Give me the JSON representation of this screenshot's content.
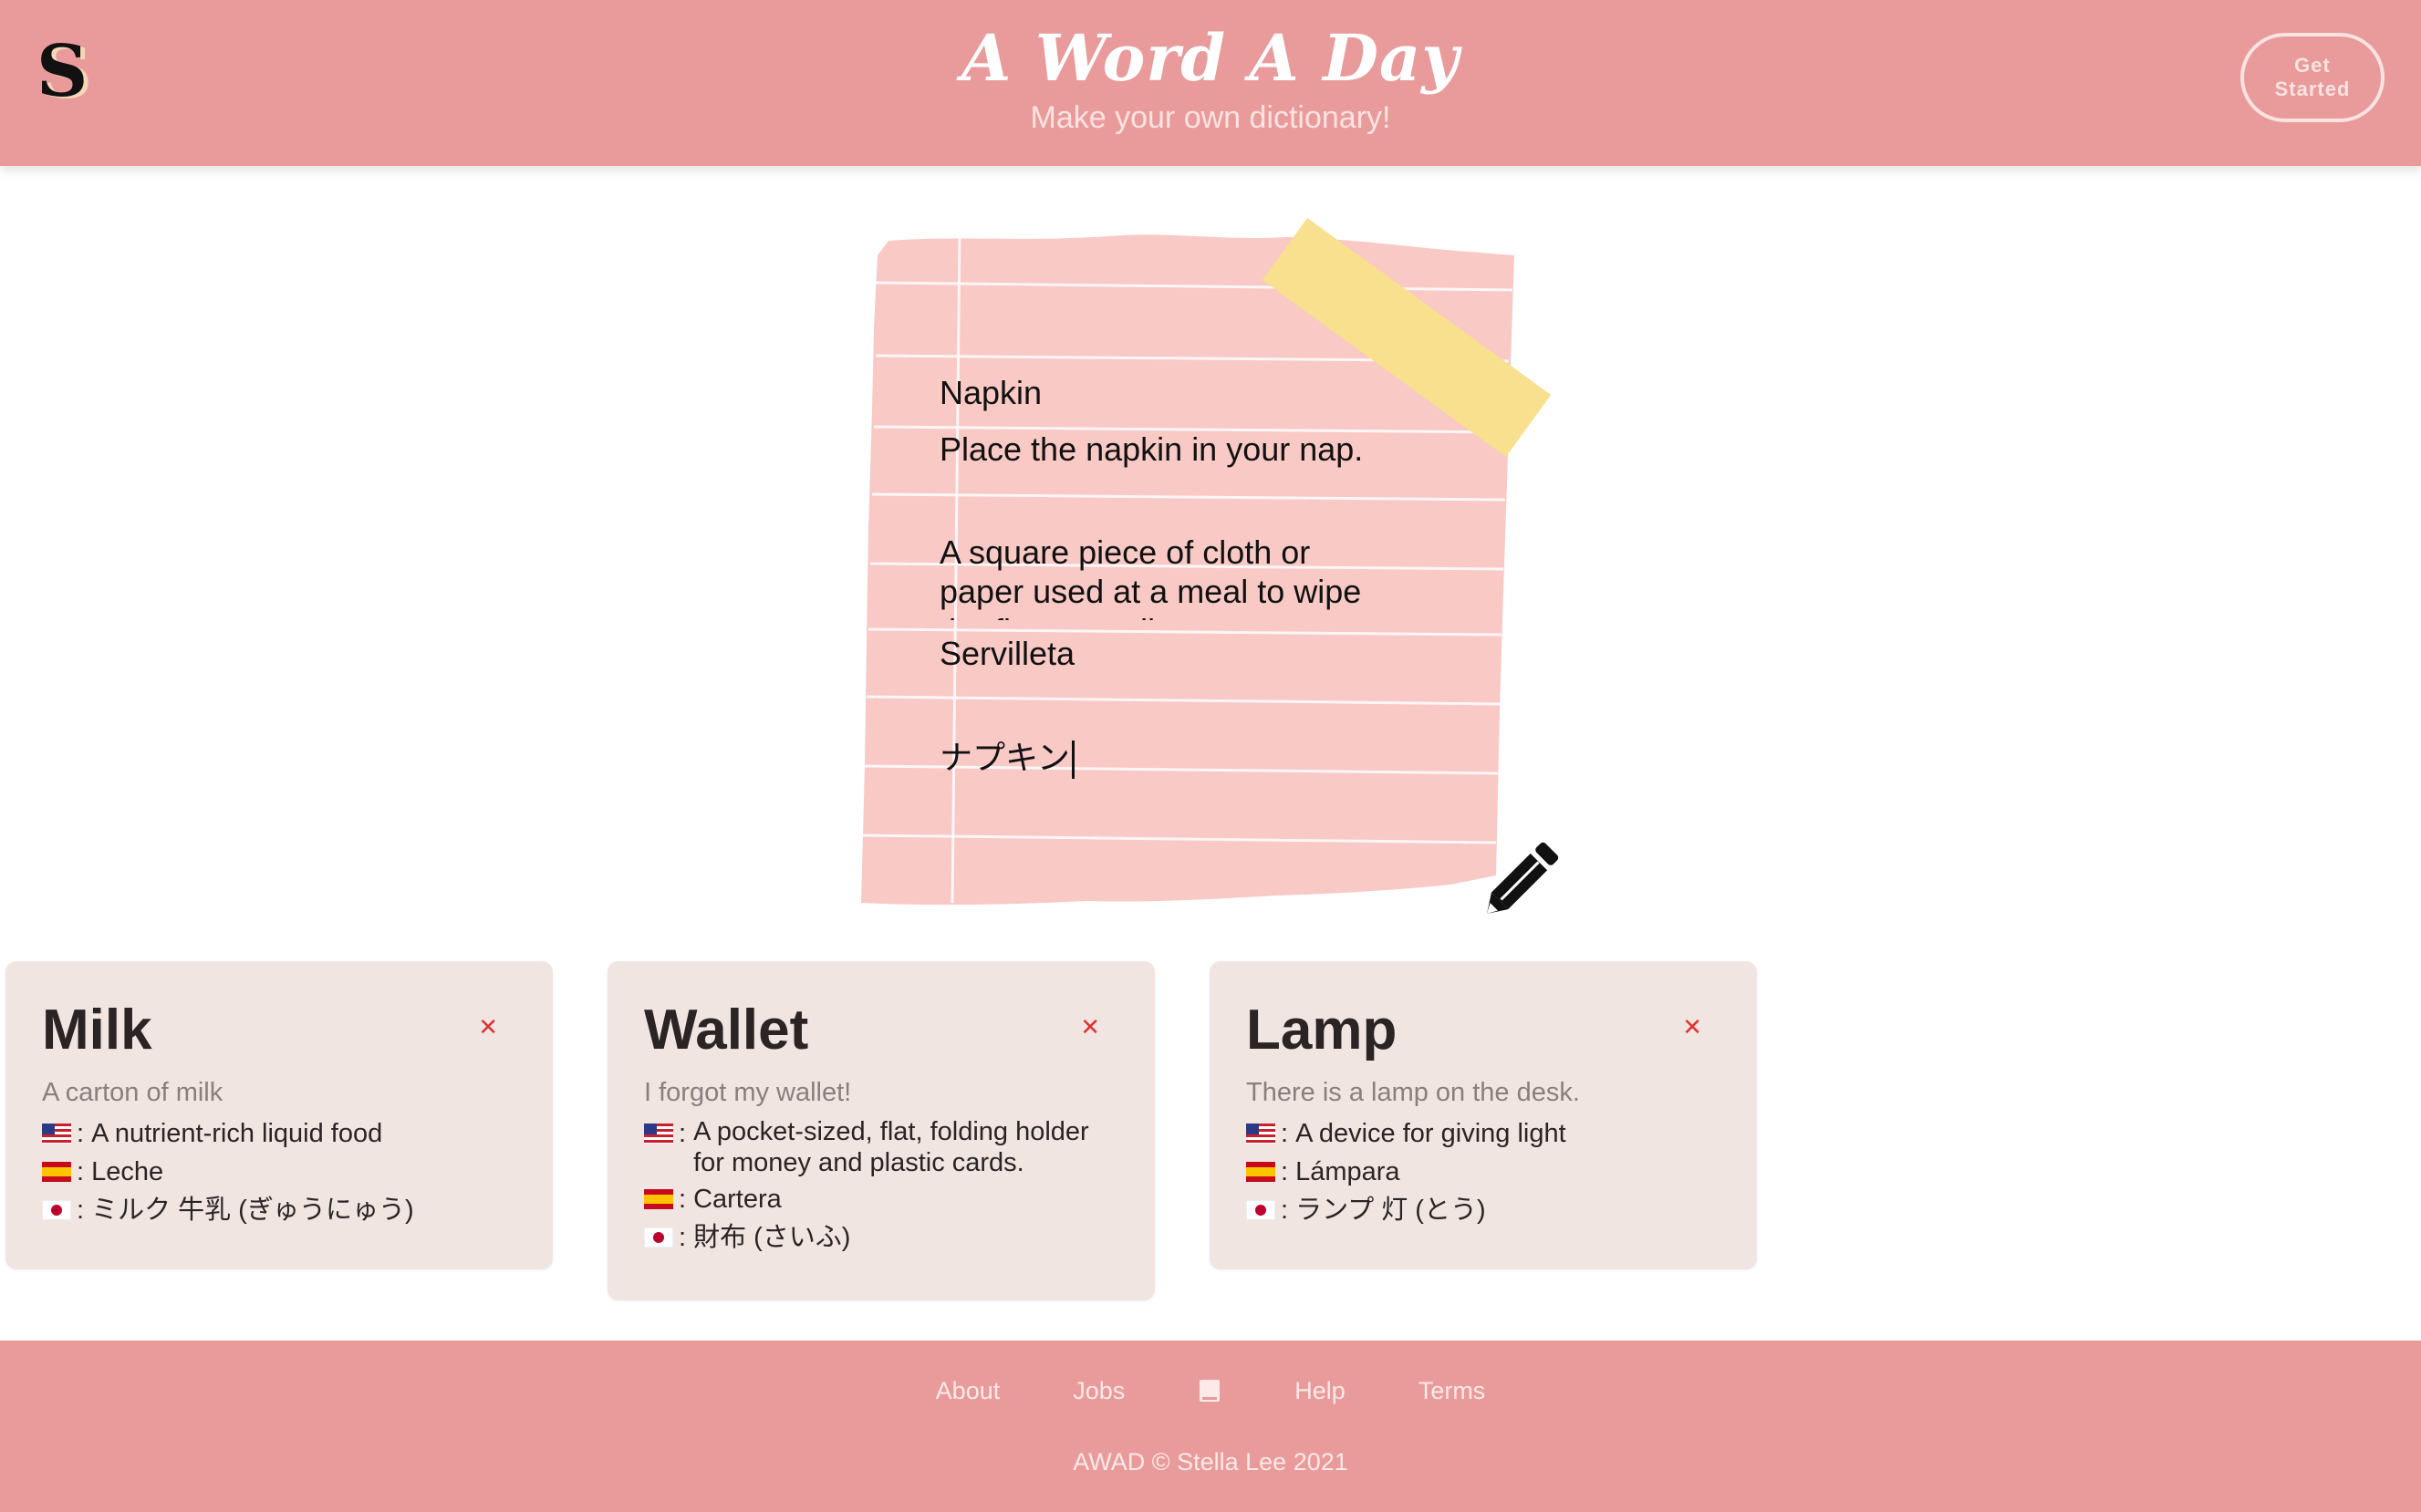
{
  "header": {
    "logo_letter": "S",
    "title": "A Word A Day",
    "subtitle": "Make your own dictionary!",
    "cta_label": "Get Started"
  },
  "note": {
    "word": "Napkin",
    "example": "Place the napkin in your nap.",
    "definition": "A square piece of cloth or paper used at a meal to wipe the fingers or lips",
    "spanish": "Servilleta",
    "japanese": "ナプキン"
  },
  "cards": [
    {
      "word": "Milk",
      "example": "A carton of milk",
      "en": "A nutrient-rich liquid food",
      "es": "Leche",
      "ja": "ミルク 牛乳 (ぎゅうにゅう)"
    },
    {
      "word": "Wallet",
      "example": "I forgot my wallet!",
      "en": "A pocket-sized, flat, folding holder for money and plastic cards.",
      "es": "Cartera",
      "ja": "財布 (さいふ)"
    },
    {
      "word": "Lamp",
      "example": "There is a lamp on the desk.",
      "en": "A device for giving light",
      "es": "Lámpara",
      "ja": "ランプ 灯 (とう)"
    }
  ],
  "footer": {
    "links": [
      "About",
      "Jobs",
      "Help",
      "Terms"
    ],
    "copyright": "AWAD © Stella Lee 2021"
  },
  "colors": {
    "header_bg": "#e99b9b",
    "note_paper": "#f8c9c5",
    "tape": "#f8e08e",
    "card_bg": "#f1e5e2",
    "delete": "#dd3333"
  },
  "icons": {
    "logo": "s-logo-icon",
    "pencil": "pencil-icon",
    "delete": "close-icon",
    "book": "book-icon"
  }
}
